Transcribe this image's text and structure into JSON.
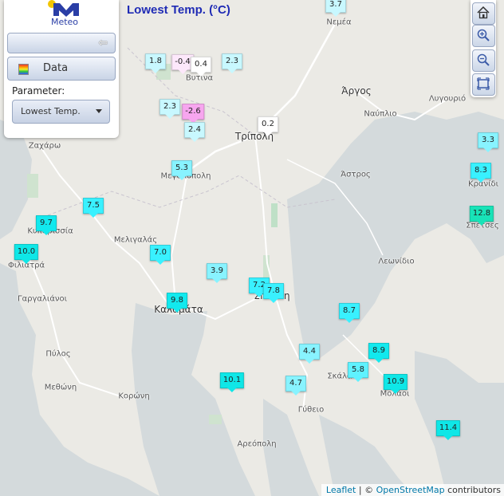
{
  "header": {
    "title": "Lowest Temp. (°C)"
  },
  "panel": {
    "logo_text": "Meteo",
    "data_label": "Data",
    "parameter_label": "Parameter:",
    "parameter_value": "Lowest Temp."
  },
  "toolbar": {
    "icons": [
      "home-icon",
      "zoom-in-icon",
      "zoom-out-icon",
      "fullscreen-icon"
    ]
  },
  "attribution": {
    "leaflet": "Leaflet",
    "sep": " | © ",
    "osm": "OpenStreetMap",
    "contrib": " contributors"
  },
  "colors": {
    "cold": "#f7a6ef",
    "near_zero": "#ffffff",
    "cool": "#c8f8ff",
    "mild": "#39f1ff",
    "warm": "#0fe7e7",
    "warmest": "#18e3b8",
    "title": "#1f2bb5"
  },
  "places": [
    {
      "name": "Νεμέα"
    },
    {
      "name": "Βυτίνα"
    },
    {
      "name": "Άργος"
    },
    {
      "name": "Ναύπλιο"
    },
    {
      "name": "Λυγουριό"
    },
    {
      "name": "Τρίπολη"
    },
    {
      "name": "Μεγαλόπολη"
    },
    {
      "name": "Ζαχάρω"
    },
    {
      "name": "Άστρος"
    },
    {
      "name": "Κρανίδι"
    },
    {
      "name": "Σπέτσες"
    },
    {
      "name": "Κυπαρισσία"
    },
    {
      "name": "Μελιγαλάς"
    },
    {
      "name": "Λεωνίδιο"
    },
    {
      "name": "Φιλιατρά"
    },
    {
      "name": "Σπάρτη"
    },
    {
      "name": "Γαργαλιάνοι"
    },
    {
      "name": "Καλαμάτα"
    },
    {
      "name": "Πύλος"
    },
    {
      "name": "Σκάλα"
    },
    {
      "name": "Μεθώνη"
    },
    {
      "name": "Μολάοι"
    },
    {
      "name": "Κορώνη"
    },
    {
      "name": "Γύθειο"
    },
    {
      "name": "Αρεόπολη"
    }
  ],
  "stations": [
    {
      "value": "3.7"
    },
    {
      "value": "1.8"
    },
    {
      "value": "-0.4"
    },
    {
      "value": "0.4"
    },
    {
      "value": "2.3"
    },
    {
      "value": "2.3"
    },
    {
      "value": "-2.6"
    },
    {
      "value": "2.4"
    },
    {
      "value": "0.2"
    },
    {
      "value": "3.3"
    },
    {
      "value": "5.3"
    },
    {
      "value": "8.3"
    },
    {
      "value": "7.5"
    },
    {
      "value": "12.8"
    },
    {
      "value": "9.7"
    },
    {
      "value": "10.0"
    },
    {
      "value": "7.0"
    },
    {
      "value": "3.9"
    },
    {
      "value": "7.2"
    },
    {
      "value": "7.8"
    },
    {
      "value": "9.8"
    },
    {
      "value": "8.7"
    },
    {
      "value": "4.4"
    },
    {
      "value": "8.9"
    },
    {
      "value": "5.8"
    },
    {
      "value": "10.1"
    },
    {
      "value": "4.7"
    },
    {
      "value": "10.9"
    },
    {
      "value": "11.4"
    }
  ]
}
